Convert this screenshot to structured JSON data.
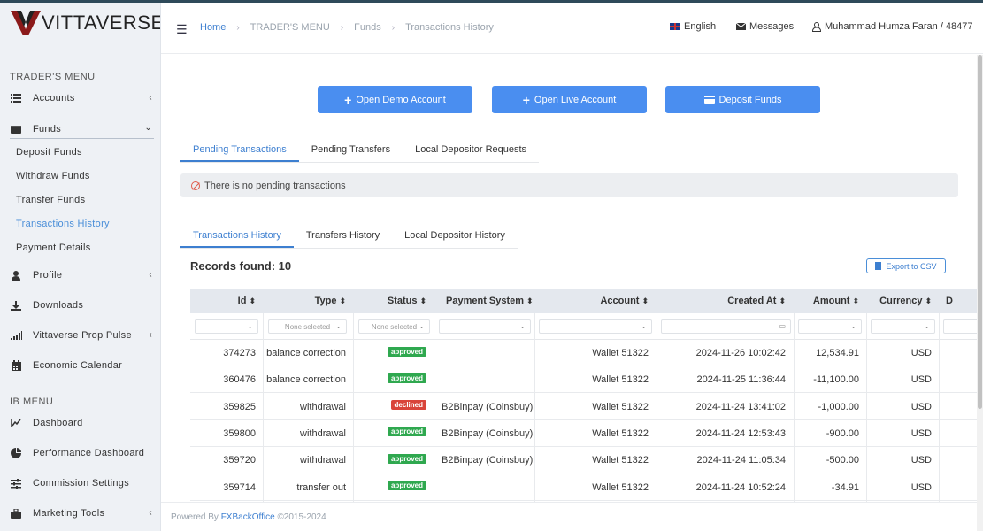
{
  "brand": {
    "name": "VITTAVERSE",
    "colors": {
      "accent": "#4a8ef0",
      "logo_red": "#8b1a1a"
    }
  },
  "sidebar": {
    "traders_menu_title": "TRADER'S MENU",
    "ib_menu_title": "IB MENU",
    "items": {
      "accounts": {
        "label": "Accounts",
        "icon": "list-icon"
      },
      "funds": {
        "label": "Funds",
        "icon": "wallet-icon"
      },
      "profile": {
        "label": "Profile",
        "icon": "user-icon"
      },
      "downloads": {
        "label": "Downloads",
        "icon": "download-icon"
      },
      "prop_pulse": {
        "label": "Vittaverse Prop Pulse",
        "icon": "signal-icon"
      },
      "calendar": {
        "label": "Economic Calendar",
        "icon": "calendar-icon"
      },
      "dashboard": {
        "label": "Dashboard",
        "icon": "chart-icon"
      },
      "performance": {
        "label": "Performance Dashboard",
        "icon": "pie-icon"
      },
      "commission": {
        "label": "Commission Settings",
        "icon": "sliders-icon"
      },
      "marketing": {
        "label": "Marketing Tools",
        "icon": "briefcase-icon"
      }
    },
    "funds_sub": {
      "deposit": "Deposit Funds",
      "withdraw": "Withdraw Funds",
      "transfer": "Transfer Funds",
      "history": "Transactions History",
      "payment": "Payment Details"
    }
  },
  "header": {
    "breadcrumb": {
      "home": "Home",
      "menu": "TRADER'S MENU",
      "funds": "Funds",
      "current": "Transactions History"
    },
    "language": "English",
    "messages": "Messages",
    "user": "Muhammad Humza Faran / 48477"
  },
  "actions": {
    "demo": "Open Demo Account",
    "live": "Open Live Account",
    "deposit": "Deposit Funds"
  },
  "pending_tabs": {
    "t1": "Pending Transactions",
    "t2": "Pending Transfers",
    "t3": "Local Depositor Requests"
  },
  "pending_alert": "There is no pending transactions",
  "history_tabs": {
    "t1": "Transactions History",
    "t2": "Transfers History",
    "t3": "Local Depositor History"
  },
  "records_found": "Records found: 10",
  "export_label": "Export to CSV",
  "table": {
    "columns": {
      "id": "Id",
      "type": "Type",
      "status": "Status",
      "payment": "Payment System",
      "account": "Account",
      "created": "Created At",
      "amount": "Amount",
      "currency": "Currency",
      "extra": "D"
    },
    "filter_none": "None selected",
    "rows": [
      {
        "id": "374273",
        "type": "balance correction",
        "status": "approved",
        "payment": "",
        "account": "Wallet 51322",
        "created": "2024-11-26 10:02:42",
        "amount": "12,534.91",
        "currency": "USD"
      },
      {
        "id": "360476",
        "type": "balance correction",
        "status": "approved",
        "payment": "",
        "account": "Wallet 51322",
        "created": "2024-11-25 11:36:44",
        "amount": "-11,100.00",
        "currency": "USD"
      },
      {
        "id": "359825",
        "type": "withdrawal",
        "status": "declined",
        "payment": "B2Binpay (Coinsbuy)",
        "account": "Wallet 51322",
        "created": "2024-11-24 13:41:02",
        "amount": "-1,000.00",
        "currency": "USD"
      },
      {
        "id": "359800",
        "type": "withdrawal",
        "status": "approved",
        "payment": "B2Binpay (Coinsbuy)",
        "account": "Wallet 51322",
        "created": "2024-11-24 12:53:43",
        "amount": "-900.00",
        "currency": "USD"
      },
      {
        "id": "359720",
        "type": "withdrawal",
        "status": "approved",
        "payment": "B2Binpay (Coinsbuy)",
        "account": "Wallet 51322",
        "created": "2024-11-24 11:05:34",
        "amount": "-500.00",
        "currency": "USD"
      },
      {
        "id": "359714",
        "type": "transfer out",
        "status": "approved",
        "payment": "",
        "account": "Wallet 51322",
        "created": "2024-11-24 10:52:24",
        "amount": "-34.91",
        "currency": "USD"
      }
    ]
  },
  "footer": {
    "powered": "Powered By",
    "link": "FXBackOffice",
    "copy": "©2015-2024"
  }
}
